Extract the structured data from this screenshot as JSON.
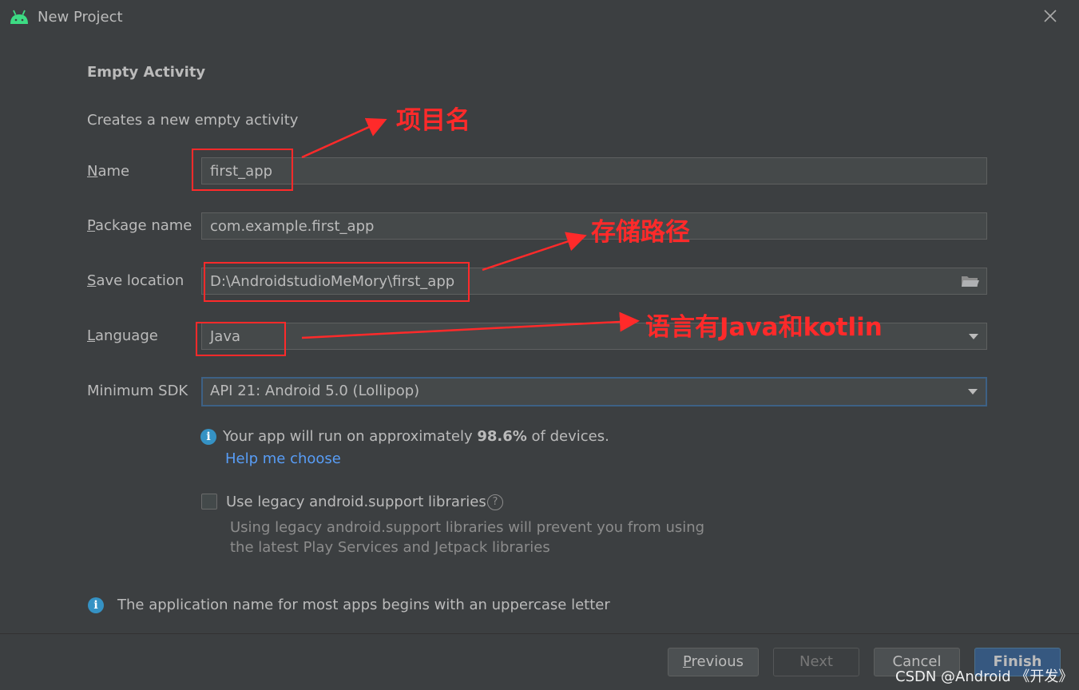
{
  "window": {
    "title": "New Project",
    "close_icon": "close-icon",
    "app_icon": "android-icon"
  },
  "template": {
    "heading": "Empty Activity",
    "description": "Creates a new empty activity"
  },
  "form": {
    "name": {
      "label_first": "N",
      "label_rest": "ame",
      "value": "first_app"
    },
    "package": {
      "label_first": "P",
      "label_rest": "ackage name",
      "value": "com.example.first_app"
    },
    "location": {
      "label_first": "S",
      "label_rest": "ave location",
      "value": "D:\\AndroidstudioMeMory\\first_app",
      "icon": "folder-icon"
    },
    "language": {
      "label_first": "L",
      "label_rest": "anguage",
      "value": "Java"
    },
    "min_sdk": {
      "label": "Minimum SDK",
      "value": "API 21: Android 5.0 (Lollipop)"
    }
  },
  "sdk_info": {
    "prefix": "Your app will run on approximately ",
    "percent": "98.6%",
    "suffix": " of devices.",
    "help_link": "Help me choose"
  },
  "legacy": {
    "checked": false,
    "label": "Use legacy android.support libraries",
    "hint_line1": "Using legacy android.support libraries will prevent you from using",
    "hint_line2": "the latest Play Services and Jetpack libraries"
  },
  "footer_info": "The application name for most apps begins with an uppercase letter",
  "buttons": {
    "previous_first": "P",
    "previous_rest": "revious",
    "next": "Next",
    "cancel": "Cancel",
    "finish": "Finish"
  },
  "annotations": {
    "name": "项目名",
    "location": "存储路径",
    "language": "语言有Java和kotlin",
    "color": "#ff2a2a"
  },
  "watermark": "CSDN @Android 《开发》",
  "colors": {
    "background": "#3c3f41",
    "link": "#589df6",
    "info": "#3592c4",
    "focus": "#3d6185"
  }
}
